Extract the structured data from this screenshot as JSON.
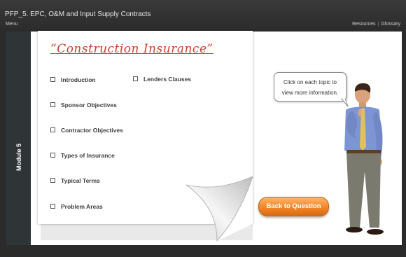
{
  "header": {
    "course_title": "PFP_5.  EPC, O&M and Input Supply Contracts",
    "menu_label": "Menu",
    "resources_label": "Resources",
    "separator": "|",
    "glossary_label": "Glossary"
  },
  "sidebar": {
    "module_label": "Module 5"
  },
  "main": {
    "title": "“Construction Insurance”",
    "topics": [
      {
        "label": "Introduction"
      },
      {
        "label": "Sponsor Objectives"
      },
      {
        "label": "Contractor Objectives"
      },
      {
        "label": "Types of Insurance"
      },
      {
        "label": "Typical Terms"
      },
      {
        "label": "Problem Areas"
      },
      {
        "label": "Lenders Clauses"
      }
    ],
    "callout": "Click on each topic to view more information.",
    "back_button": "Back to Question"
  },
  "colors": {
    "title_red": "#d13c30",
    "button_orange": "#ef8224",
    "chrome_dark": "#2b2b2b"
  }
}
